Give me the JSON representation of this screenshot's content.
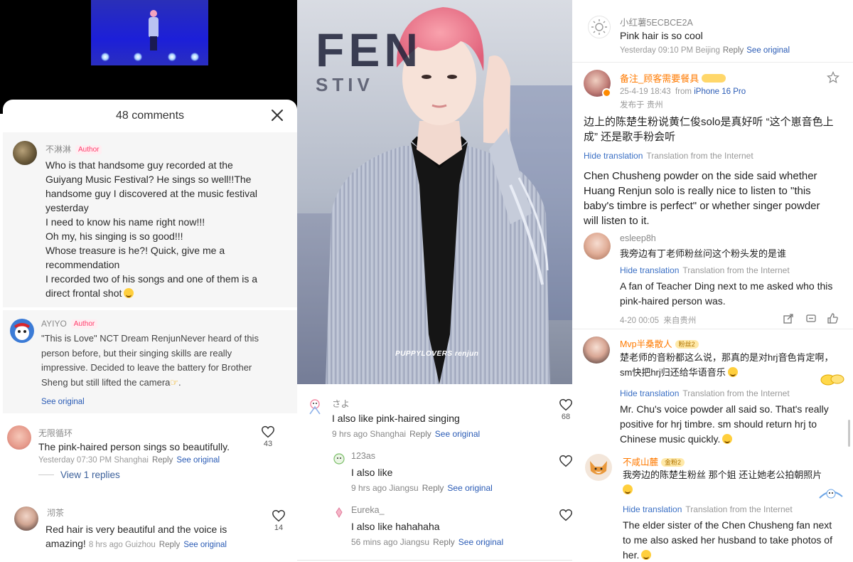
{
  "panel1": {
    "comments_header": "48 comments",
    "comments": [
      {
        "user": "不淋淋",
        "tag": "Author",
        "lines": [
          "Who is that handsome guy recorded at the",
          "Guiyang Music Festival? He sings so well!!The",
          "handsome guy I discovered at the music festival",
          "yesterday",
          "I need to know his name right now!!!",
          "Oh my, his singing is so good!!!",
          "Whose treasure is he?! Quick, give me a",
          "recommendation",
          "I recorded two of his songs and one of them is a",
          "direct frontal shot"
        ]
      },
      {
        "user": "AYIYO",
        "tag": "Author",
        "lines": [
          "\"This is Love\" NCT Dream RenjunNever heard of this",
          "person before, but their singing skills are really",
          "impressive. Decided to leave the battery for Brother",
          "Sheng but still lifted the camera"
        ],
        "see_original": "See original"
      },
      {
        "user": "无限循环",
        "text": "The pink-haired person sings so beautifully.",
        "time": "Yesterday 07:30 PM Shanghai",
        "reply": "Reply",
        "see_original": "See original",
        "likes": "43",
        "view_replies": "View 1 replies"
      },
      {
        "user": "沏茶",
        "text_line1": "Red hair is very beautiful and the voice is",
        "text_line2": "amazing!",
        "time": "8 hrs ago Guizhou",
        "reply": "Reply",
        "see_original": "See original",
        "likes": "14"
      }
    ]
  },
  "panel2": {
    "watermark": "PUPPYLOVERS renjun",
    "backdrop_letters": "FEN",
    "backdrop_letters2": "STIV",
    "comments": [
      {
        "user": "さよ",
        "text": "I also like pink-haired singing",
        "time": "9 hrs ago Shanghai",
        "reply": "Reply",
        "see_original": "See original",
        "likes": "68"
      },
      {
        "user": "123as",
        "text": "I also like",
        "time": "9 hrs ago Jiangsu",
        "reply": "Reply",
        "see_original": "See original"
      },
      {
        "user": "Eureka_",
        "text": "I also like hahahaha",
        "time": "56 mins ago Jiangsu",
        "reply": "Reply",
        "see_original": "See original"
      }
    ]
  },
  "panel3": {
    "top_comment": {
      "user": "小红薯5ECBCE2A",
      "text": "Pink hair is so cool",
      "time": "Yesterday 09:10 PM Beijing",
      "reply": "Reply",
      "see_original": "See original"
    },
    "post": {
      "user": "备注_顾客需要餐具",
      "date": "25-4-19 18:43",
      "from_label": "from",
      "device": "iPhone 16 Pro",
      "location": "发布于 贵州",
      "text_cn_line1": "边上的陈楚生粉说黄仁俊solo是真好听 “这个崽音色上",
      "text_cn_line2": "成” 还是歌手粉会听",
      "hide_translation": "Hide translation",
      "translation_source": "Translation from the Internet",
      "text_en": [
        "Chen Chusheng powder on the side said whether",
        "Huang Renjun solo is really nice to listen to \"this",
        "baby's timbre is perfect\" or whether singer powder",
        "will listen to it."
      ]
    },
    "replies": [
      {
        "user": "esleep8h",
        "text_cn": "我旁边有丁老师粉丝问这个粉头发的是谁",
        "hide_translation": "Hide translation",
        "translation_source": "Translation from the Internet",
        "text_en": [
          "A fan of Teacher Ding next to me asked who this",
          "pink-haired person was."
        ],
        "time": "4-20 00:05",
        "place": "来自贵州"
      },
      {
        "user": "Mvp半桑散人",
        "badge": "粉丝2",
        "text_cn": [
          "楚老师的音粉都这么说，那真的是对hrj音色肯定啊，",
          "sm快把hrj归还给华语音乐"
        ],
        "hide_translation": "Hide translation",
        "translation_source": "Translation from the Internet",
        "text_en": [
          "Mr. Chu's voice powder all said so. That's really",
          "positive for hrj timbre. sm should return hrj to",
          "Chinese music quickly."
        ]
      },
      {
        "user": "不咸山麓",
        "badge": "金粉2",
        "text_cn": [
          "我旁边的陈楚生粉丝 那个姐 还让她老公拍朝照片"
        ],
        "hide_translation": "Hide translation",
        "translation_source": "Translation from the Internet",
        "text_en": [
          "The elder sister of the Chen Chusheng fan next",
          "to me also asked her husband to take photos of",
          "her."
        ]
      }
    ]
  },
  "colors": {
    "link_blue": "#2a5bb5",
    "author_tag": "#ff3d6b",
    "username_orange": "#ff7a00",
    "hair_pink": "#f07a8c"
  }
}
